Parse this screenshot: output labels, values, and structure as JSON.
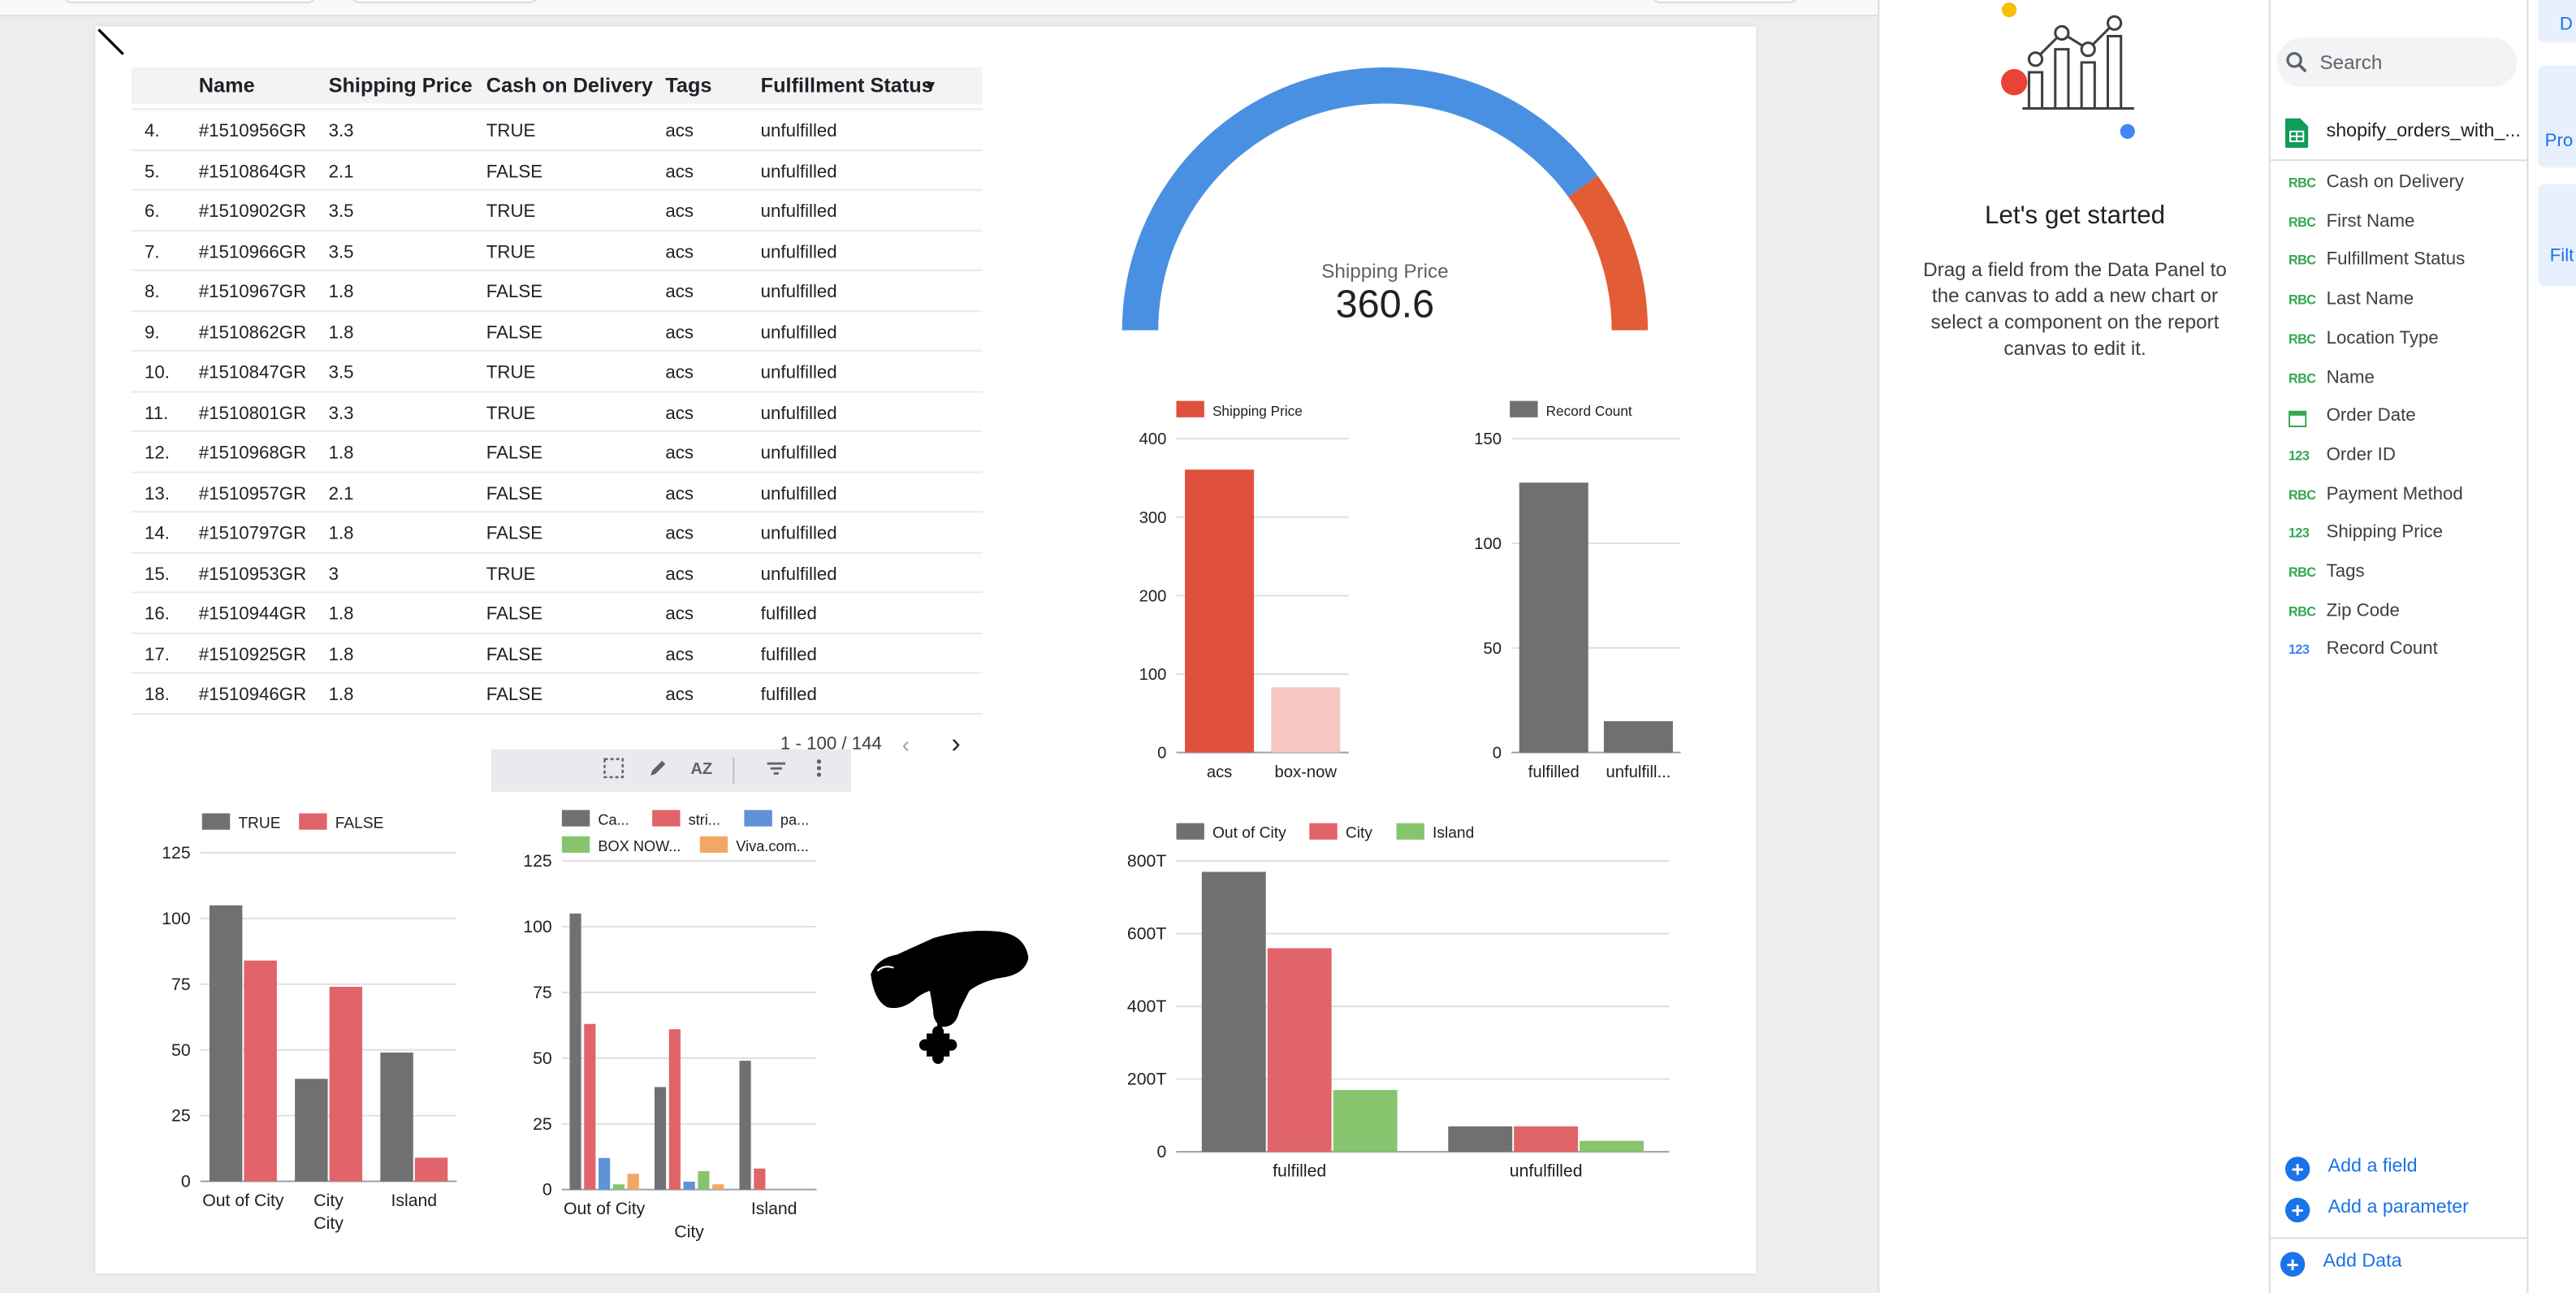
{
  "table": {
    "headers": [
      "Name",
      "Shipping Price",
      "Cash on Delivery",
      "Tags",
      "Fulfillment Status"
    ],
    "sort_indicator": "▼",
    "rows": [
      [
        "4.",
        "#1510956GR",
        "3.3",
        "TRUE",
        "acs",
        "unfulfilled"
      ],
      [
        "5.",
        "#1510864GR",
        "2.1",
        "FALSE",
        "acs",
        "unfulfilled"
      ],
      [
        "6.",
        "#1510902GR",
        "3.5",
        "TRUE",
        "acs",
        "unfulfilled"
      ],
      [
        "7.",
        "#1510966GR",
        "3.5",
        "TRUE",
        "acs",
        "unfulfilled"
      ],
      [
        "8.",
        "#1510967GR",
        "1.8",
        "FALSE",
        "acs",
        "unfulfilled"
      ],
      [
        "9.",
        "#1510862GR",
        "1.8",
        "FALSE",
        "acs",
        "unfulfilled"
      ],
      [
        "10.",
        "#1510847GR",
        "3.5",
        "TRUE",
        "acs",
        "unfulfilled"
      ],
      [
        "11.",
        "#1510801GR",
        "3.3",
        "TRUE",
        "acs",
        "unfulfilled"
      ],
      [
        "12.",
        "#1510968GR",
        "1.8",
        "FALSE",
        "acs",
        "unfulfilled"
      ],
      [
        "13.",
        "#1510957GR",
        "2.1",
        "FALSE",
        "acs",
        "unfulfilled"
      ],
      [
        "14.",
        "#1510797GR",
        "1.8",
        "FALSE",
        "acs",
        "unfulfilled"
      ],
      [
        "15.",
        "#1510953GR",
        "3",
        "TRUE",
        "acs",
        "unfulfilled"
      ],
      [
        "16.",
        "#1510944GR",
        "1.8",
        "FALSE",
        "acs",
        "fulfilled"
      ],
      [
        "17.",
        "#1510925GR",
        "1.8",
        "FALSE",
        "acs",
        "fulfilled"
      ],
      [
        "18.",
        "#1510946GR",
        "1.8",
        "FALSE",
        "acs",
        "fulfilled"
      ]
    ],
    "pagination": "1 - 100 / 144",
    "prev_icon": "chevron-left-icon",
    "next_icon": "chevron-right-icon"
  },
  "toolbar": {
    "icons": [
      "select-icon",
      "pencil-icon",
      "sort-az-icon",
      "filter-icon",
      "more-vert-icon"
    ]
  },
  "colors": {
    "blue": "#4a90e2",
    "orange": "#e25c35",
    "red": "#e0503e",
    "pink_light": "#f5c6c2",
    "gray": "#707070",
    "salmon": "#e06469",
    "steel_blue": "#5f92d6",
    "green": "#88c46e",
    "amber": "#f2a766",
    "link_blue": "#1a73e8"
  },
  "chart_data": [
    {
      "type": "gauge",
      "label": "Shipping Price",
      "value_text": "360.6",
      "value": 360.6,
      "filled_fraction": 0.8
    },
    {
      "type": "bar",
      "legend": [
        "Shipping Price"
      ],
      "categories": [
        "acs",
        "box-now"
      ],
      "series": [
        {
          "name": "Shipping Price",
          "values": [
            360.6,
            83
          ]
        }
      ],
      "ylim": [
        0,
        400
      ],
      "yticks": [
        "0",
        "100",
        "200",
        "300",
        "400"
      ]
    },
    {
      "type": "bar",
      "legend": [
        "Record Count"
      ],
      "categories": [
        "fulfilled",
        "unfulfill..."
      ],
      "series": [
        {
          "name": "Record Count",
          "values": [
            129,
            15
          ]
        }
      ],
      "ylim": [
        0,
        150
      ],
      "yticks": [
        "0",
        "50",
        "100",
        "150"
      ]
    },
    {
      "type": "bar",
      "categories": [
        "Out of City",
        "City",
        "Island"
      ],
      "xlabel": "City",
      "series": [
        {
          "name": "TRUE",
          "values": [
            105,
            39,
            49
          ]
        },
        {
          "name": "FALSE",
          "values": [
            84,
            74,
            9
          ]
        }
      ],
      "ylim": [
        0,
        125
      ],
      "yticks": [
        "0",
        "25",
        "50",
        "75",
        "100",
        "125"
      ]
    },
    {
      "type": "bar",
      "categories": [
        "Out of City",
        "City",
        "Island"
      ],
      "xtick_labels": [
        "Out of City",
        "Island"
      ],
      "xlabel": "City",
      "legend": [
        "Ca...",
        "stri...",
        "pa...",
        "BOX NOW...",
        "Viva.com..."
      ],
      "series": [
        {
          "name": "Ca...",
          "values": [
            105,
            39,
            49
          ]
        },
        {
          "name": "stri...",
          "values": [
            63,
            61,
            8
          ]
        },
        {
          "name": "pa...",
          "values": [
            12,
            3,
            0
          ]
        },
        {
          "name": "BOX NOW...",
          "values": [
            2,
            7,
            0
          ]
        },
        {
          "name": "Viva.com...",
          "values": [
            6,
            2,
            0
          ]
        }
      ],
      "ylim": [
        0,
        125
      ],
      "yticks": [
        "0",
        "25",
        "50",
        "75",
        "100",
        "125"
      ]
    },
    {
      "type": "bar",
      "categories": [
        "fulfilled",
        "unfulfilled"
      ],
      "series": [
        {
          "name": "Out of City",
          "values": [
            770,
            70
          ]
        },
        {
          "name": "City",
          "values": [
            560,
            70
          ]
        },
        {
          "name": "Island",
          "values": [
            170,
            30
          ]
        }
      ],
      "ylim": [
        0,
        800
      ],
      "yticks": [
        "0",
        "200T",
        "400T",
        "600T",
        "800T"
      ]
    }
  ],
  "right_panel": {
    "title": "Let's get started",
    "body": "Drag a field from the Data Panel to the canvas to add a new chart or select a component on the report canvas to edit it."
  },
  "data_panel": {
    "search_placeholder": "Search",
    "source": "shopify_orders_with_...",
    "fields": [
      {
        "type": "ABC",
        "name": "Cash on Delivery"
      },
      {
        "type": "ABC",
        "name": "First Name"
      },
      {
        "type": "ABC",
        "name": "Fulfillment Status"
      },
      {
        "type": "ABC",
        "name": "Last Name"
      },
      {
        "type": "ABC",
        "name": "Location Type"
      },
      {
        "type": "ABC",
        "name": "Name"
      },
      {
        "type": "date",
        "name": "Order Date"
      },
      {
        "type": "123",
        "name": "Order ID"
      },
      {
        "type": "ABC",
        "name": "Payment Method"
      },
      {
        "type": "123",
        "name": "Shipping Price"
      },
      {
        "type": "ABC",
        "name": "Tags"
      },
      {
        "type": "ABC",
        "name": "Zip Code"
      },
      {
        "type": "123",
        "name": "Record Count"
      }
    ],
    "add_field": "Add a field",
    "add_parameter": "Add a parameter",
    "add_data": "Add Data"
  },
  "side_tabs": [
    "D",
    "Pro",
    "Filt"
  ]
}
